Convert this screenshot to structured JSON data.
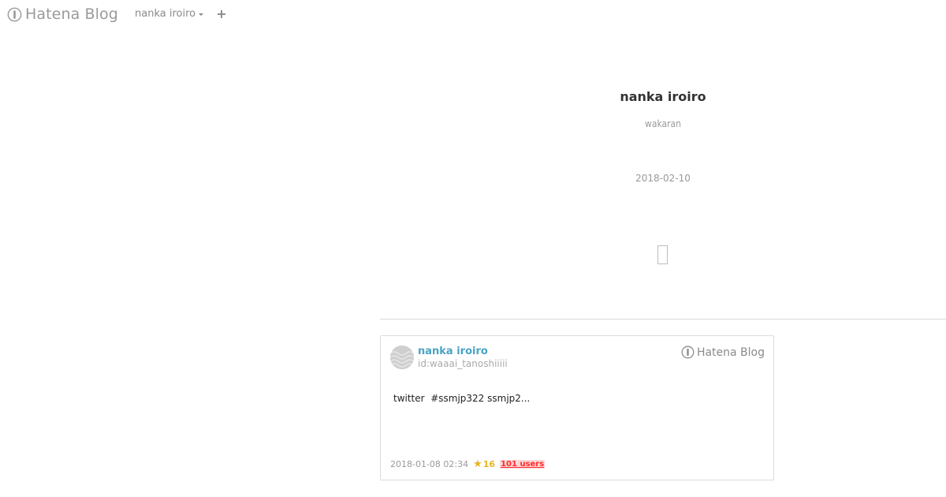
{
  "topbar": {
    "brand_label": "Hatena Blog",
    "blog_menu_label": "nanka iroiro",
    "plus_symbol": "+"
  },
  "blog_header": {
    "title": "nanka iroiro",
    "description": "wakaran",
    "date": "2018-02-10"
  },
  "embed_card": {
    "author_name": "nanka iroiro",
    "author_id": "id:waaai_tanoshiiiii",
    "brand_label": "Hatena Blog",
    "excerpt": "twitter  #ssmjp322 ssmjp2...",
    "date": "2018-01-08 02:34",
    "star_count": "16",
    "bookmark_users": "101 users"
  },
  "colors": {
    "brand_gray": "#9a9a9a",
    "link_blue": "#4aa3c4",
    "star_gold": "#e6b422",
    "users_red": "#ff2b2b",
    "users_bg": "#fbd7d7"
  },
  "icons": {
    "brand": "hatena-blog-logo-icon",
    "menu_caret": "caret-down-icon",
    "plus": "plus-icon",
    "star": "star-icon",
    "avatar": "avatar-pattern-icon"
  }
}
